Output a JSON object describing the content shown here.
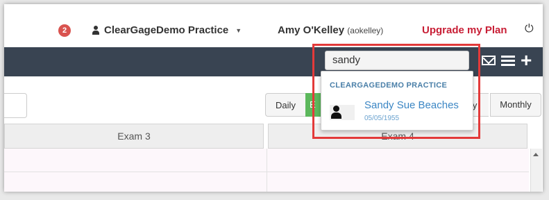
{
  "topbar": {
    "notification_count": "2",
    "practice_name": "ClearGageDemo Practice",
    "user_name": "Amy O'Kelley",
    "user_login": "(aokelley)",
    "upgrade_label": "Upgrade my Plan"
  },
  "navbar": {
    "search_value": "sandy"
  },
  "view_buttons": {
    "daily": "Daily",
    "partial_green": "E",
    "partial_y": "ly",
    "monthly": "Monthly"
  },
  "columns": [
    "Exam 3",
    "Exam 4"
  ],
  "search_dropdown": {
    "heading": "CLEARGAGEDEMO PRACTICE",
    "results": [
      {
        "name": "Sandy Sue Beaches",
        "dob": "05/05/1955"
      }
    ]
  },
  "icons": {
    "user": "user-icon",
    "caret": "caret-down-icon",
    "power": "power-icon",
    "mail": "envelope-icon",
    "menu": "hamburger-menu-icon",
    "add": "plus-icon",
    "avatar": "person-silhouette-icon"
  },
  "colors": {
    "navbar": "#394452",
    "upgrade": "#c81e35",
    "badge": "#d9534f",
    "highlight": "#e33a3a",
    "active_view": "#5cb85c",
    "result_name": "#3b86c4"
  }
}
